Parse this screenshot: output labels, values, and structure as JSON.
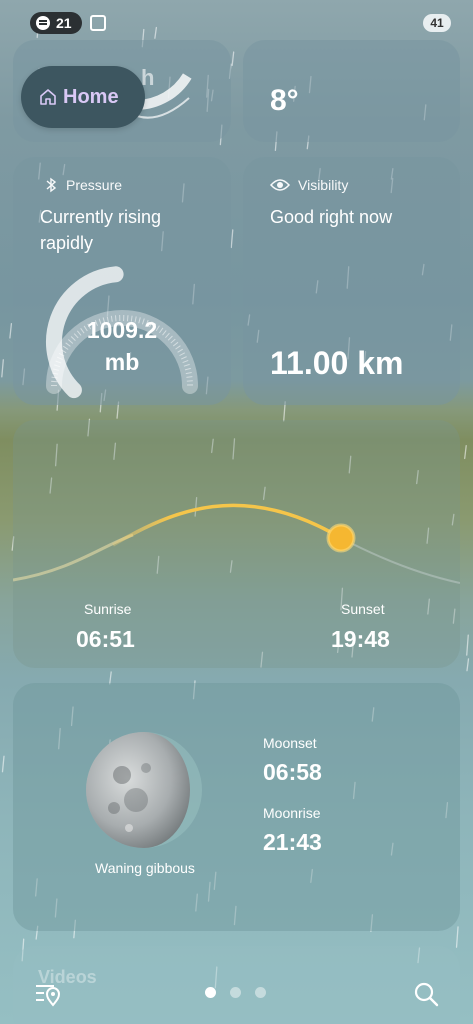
{
  "status_bar": {
    "spotify_count": "21",
    "battery": "41"
  },
  "home": {
    "label": "Home"
  },
  "temperature_card": {
    "value": "8°"
  },
  "pressure": {
    "title": "Pressure",
    "description": "Currently rising rapidly",
    "value": "1009.2",
    "unit": "mb",
    "level": 0.48
  },
  "visibility": {
    "title": "Visibility",
    "description": "Good right now",
    "value": "11.00 km"
  },
  "sun": {
    "sunrise_label": "Sunrise",
    "sunrise_time": "06:51",
    "sunset_label": "Sunset",
    "sunset_time": "19:48",
    "sun_color": "#f5b731"
  },
  "moon": {
    "phase": "Waning gibbous",
    "moonset_label": "Moonset",
    "moonset_time": "06:58",
    "moonrise_label": "Moonrise",
    "moonrise_time": "21:43"
  },
  "videos": {
    "label": "Videos"
  },
  "pagination": {
    "pages": 3,
    "active": 0
  },
  "icons": [
    "spotify-icon",
    "screen-record-icon",
    "home-icon",
    "bluetooth-pressure-icon",
    "eye-icon",
    "sun-icon",
    "moon-icon",
    "location-list-icon",
    "search-icon"
  ]
}
